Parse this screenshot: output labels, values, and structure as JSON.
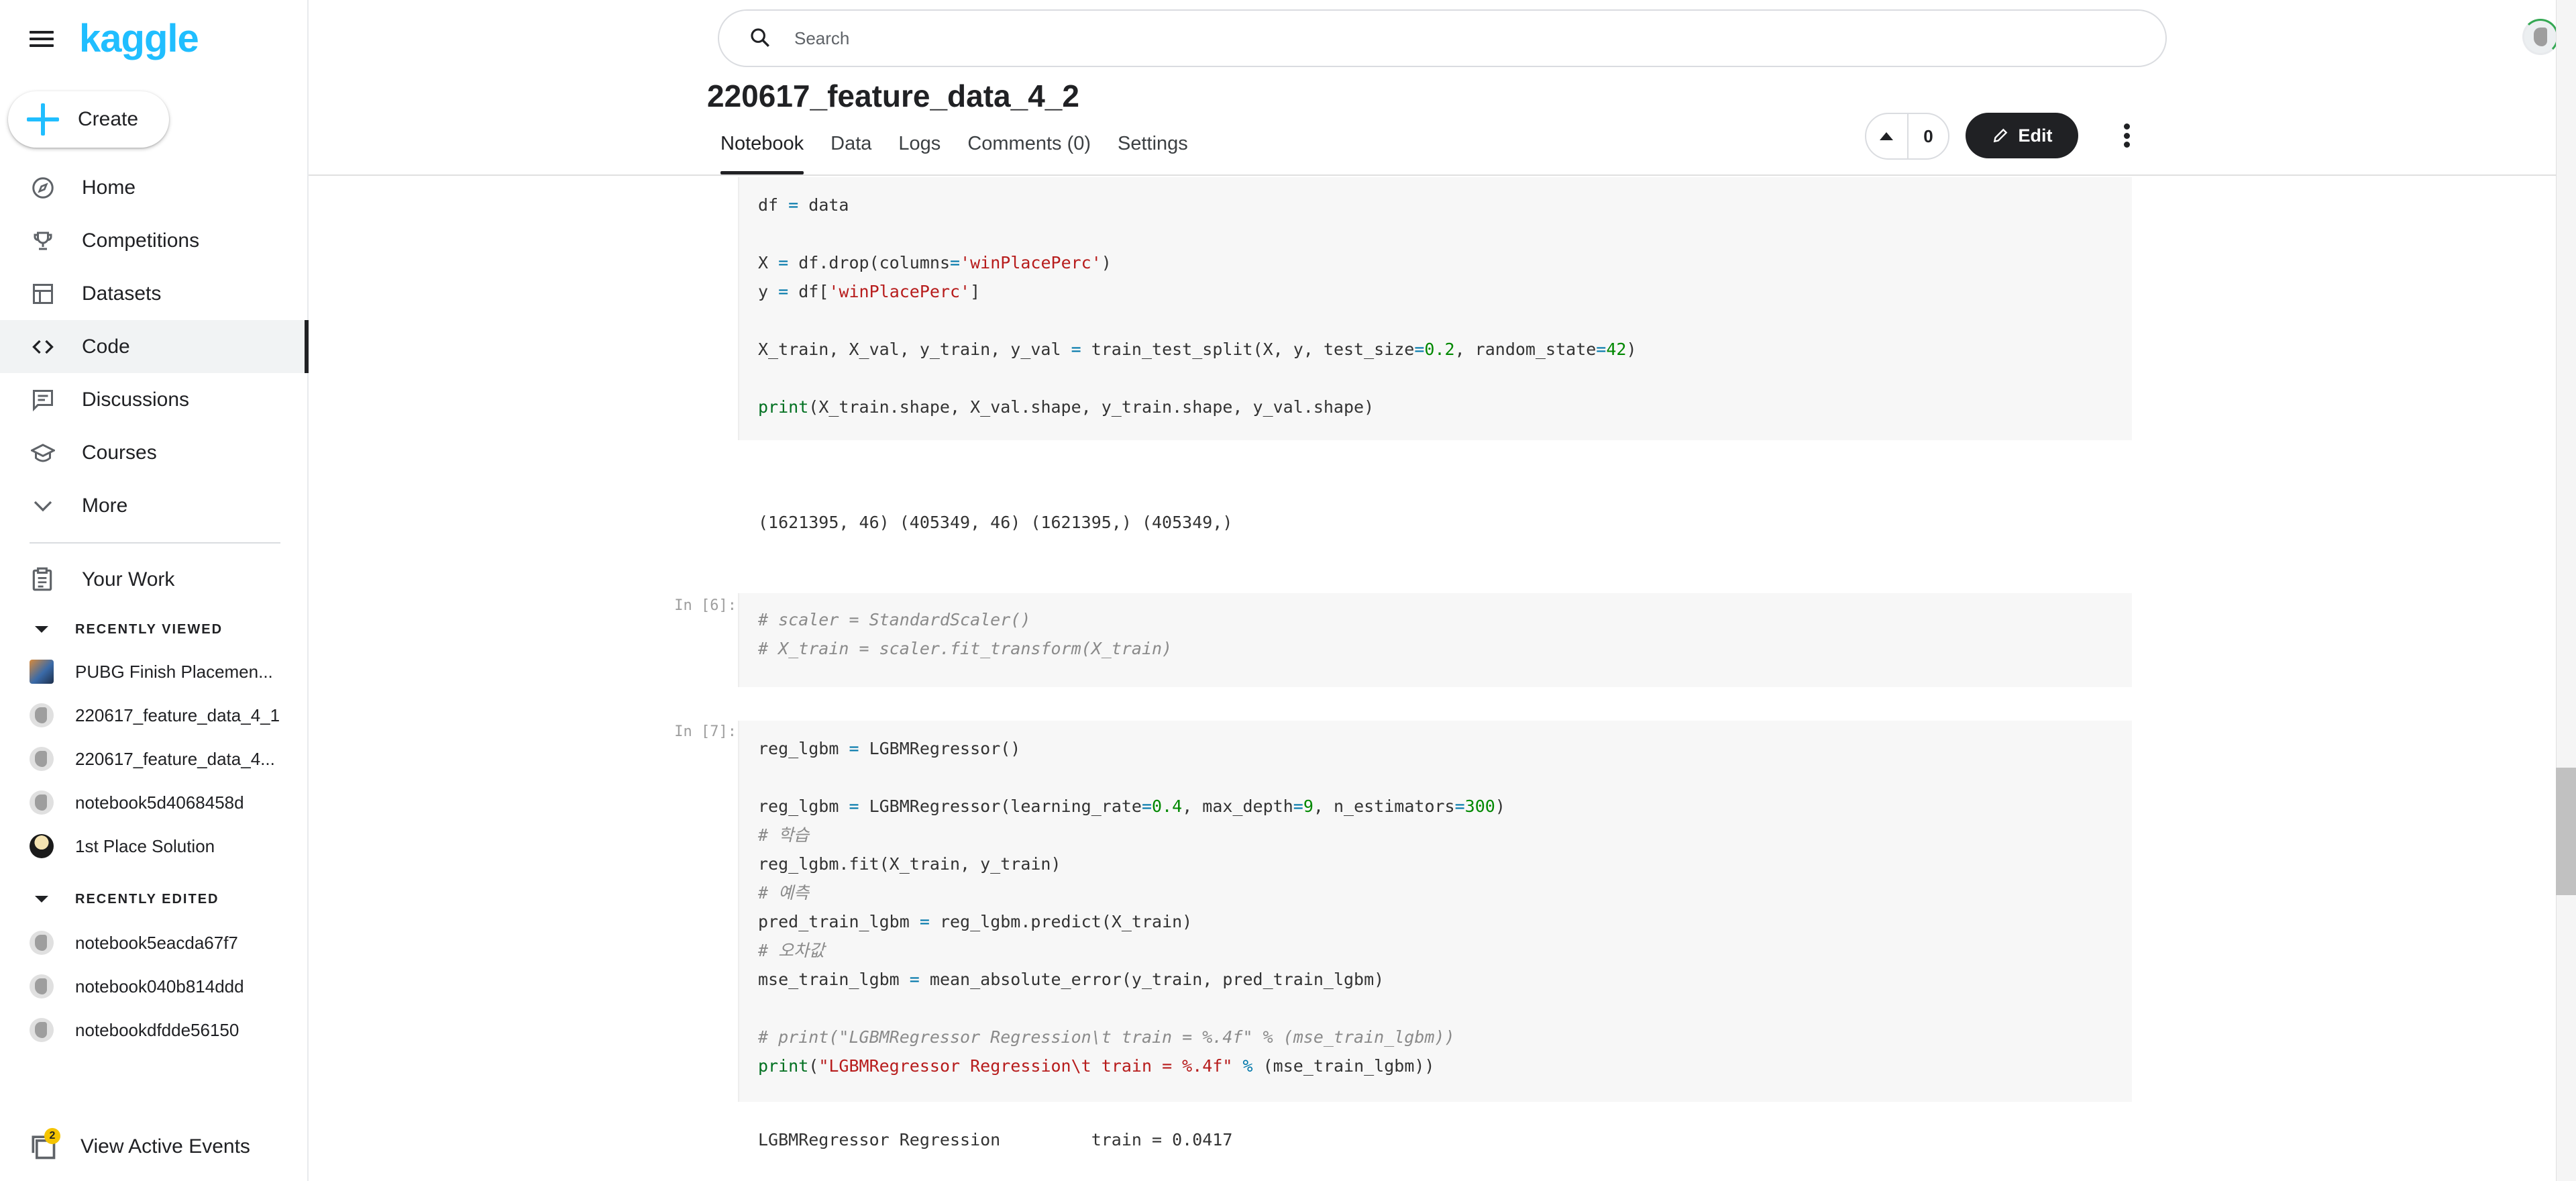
{
  "app": {
    "logo": "kaggle"
  },
  "sidebar": {
    "create_label": "Create",
    "nav": [
      {
        "label": "Home",
        "icon": "compass-icon"
      },
      {
        "label": "Competitions",
        "icon": "trophy-icon"
      },
      {
        "label": "Datasets",
        "icon": "table-icon"
      },
      {
        "label": "Code",
        "icon": "code-icon",
        "active": true
      },
      {
        "label": "Discussions",
        "icon": "forum-icon"
      },
      {
        "label": "Courses",
        "icon": "school-icon"
      },
      {
        "label": "More",
        "icon": "chevron-down-icon"
      }
    ],
    "your_work": "Your Work",
    "recently_viewed_title": "RECENTLY VIEWED",
    "recently_viewed": [
      "PUBG Finish Placemen...",
      "220617_feature_data_4_1",
      "220617_feature_data_4...",
      "notebook5d4068458d",
      "1st Place Solution"
    ],
    "recently_edited_title": "RECENTLY EDITED",
    "recently_edited": [
      "notebook5eacda67f7",
      "notebook040b814ddd",
      "notebookdfdde56150"
    ],
    "active_events_label": "View Active Events",
    "active_events_count": "2"
  },
  "header": {
    "search_placeholder": "Search",
    "notebook_title": "220617_feature_data_4_2",
    "tabs": [
      "Notebook",
      "Data",
      "Logs",
      "Comments (0)",
      "Settings"
    ],
    "vote_count": "0",
    "edit_label": "Edit"
  },
  "cells": {
    "prompt_6": "In [6]:",
    "prompt_7": "In [7]:",
    "output_5": "(1621395, 46) (405349, 46) (1621395,) (405349,)",
    "output_7": "LGBMRegressor Regression\t train = 0.0417"
  },
  "colors": {
    "brand": "#20beff",
    "code_bg": "#f7f7f7",
    "string": "#b71c1c",
    "operator": "#0077aa",
    "number": "#008800"
  }
}
